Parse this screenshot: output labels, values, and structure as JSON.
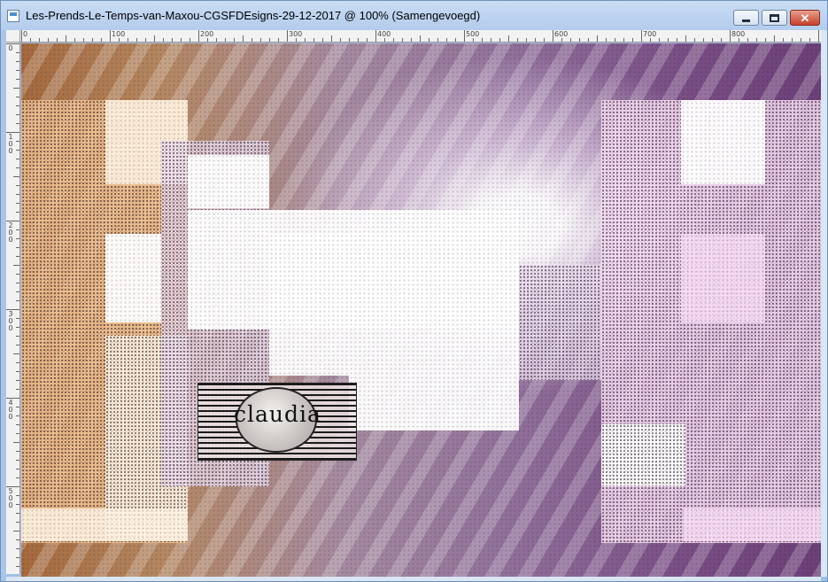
{
  "window": {
    "title": "Les-Prends-Le-Temps-van-Maxou-CGSFDEsigns-29-12-2017  @ 100% (Samengevoegd)",
    "close_glyph": "✕"
  },
  "ruler": {
    "top_labels": [
      "0",
      "100",
      "200",
      "300",
      "400",
      "500",
      "600",
      "700",
      "800"
    ],
    "left_labels": [
      "0",
      "100",
      "200",
      "300",
      "400",
      "500"
    ]
  },
  "watermark": {
    "text": "claudia"
  },
  "colors": {
    "titlebar": "#b3cced",
    "close_button": "#c7402a",
    "canvas_warm": "#a5693d",
    "canvas_purple": "#6c3f78"
  },
  "icons": [
    "app-icon",
    "minimize-icon",
    "maximize-icon",
    "close-icon"
  ]
}
